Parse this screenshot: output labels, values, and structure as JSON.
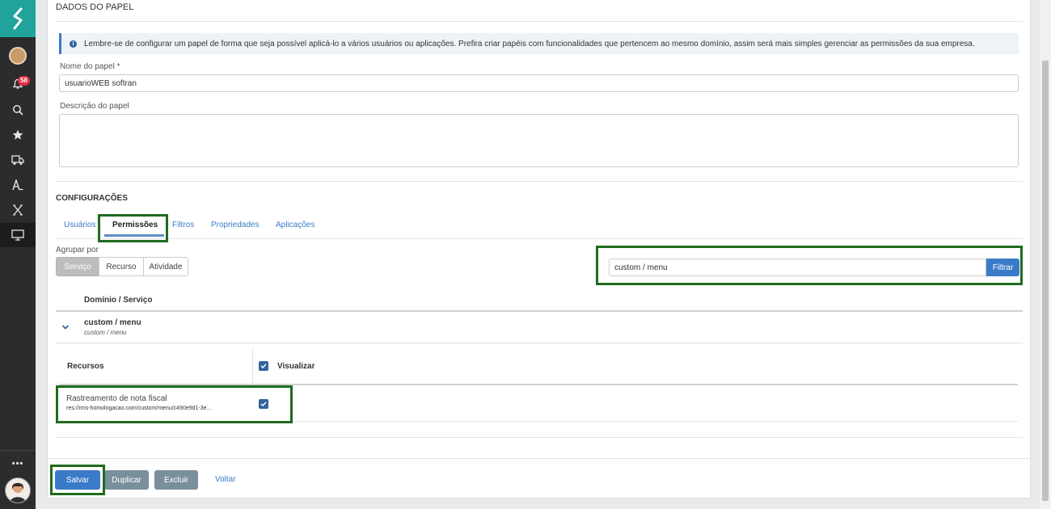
{
  "app": {
    "logo_glyph": "S",
    "notification_count": "58",
    "more_label": "•••",
    "accent_color": "#1fa39a",
    "link_color": "#3a7bc8"
  },
  "sidebar": {
    "items": [
      {
        "icon": "bell-icon"
      },
      {
        "icon": "search-icon"
      },
      {
        "icon": "star-icon"
      },
      {
        "icon": "truck-icon"
      },
      {
        "icon": "user-settings-icon"
      },
      {
        "icon": "x-icon"
      },
      {
        "icon": "monitor-icon"
      }
    ]
  },
  "dados": {
    "title": "DADOS DO PAPEL",
    "info_text": "Lembre-se de configurar um papel de forma que seja possível aplicá-lo a vários usuários ou aplicações. Prefira criar papéis com funcionalidades que pertencem ao mesmo domínio, assim será mais simples gerenciar as permissões da sua empresa.",
    "nome_label": "Nome do papel *",
    "nome_value": "usuarioWEB softran",
    "descricao_label": "Descrição do papel",
    "descricao_value": ""
  },
  "config": {
    "title": "CONFIGURAÇÕES",
    "tabs": [
      "Usuários",
      "Permissões",
      "Filtros",
      "Propriedades",
      "Aplicações"
    ],
    "active_tab": "Permissões",
    "group_label": "Agrupar por",
    "group_options": [
      "Serviço",
      "Recurso",
      "Atividade"
    ],
    "group_selected": "Serviço",
    "filter_value": "custom / menu",
    "filter_button": "Filtrar",
    "domain_header": "Domínio / Serviço",
    "domain": {
      "name": "custom / menu",
      "sub": "custom / menu"
    },
    "recursos_header": "Recursos",
    "visualizar_header": "Visualizar",
    "resources": [
      {
        "name": "Rastreamento de nota fiscal",
        "path": "res://rms-homologacao.com/custom/menu/c490e9d1-3e...",
        "visualizar": true
      }
    ]
  },
  "actions": {
    "salvar": "Salvar",
    "duplicar": "Duplicar",
    "excluir": "Excluir",
    "voltar": "Voltar"
  }
}
